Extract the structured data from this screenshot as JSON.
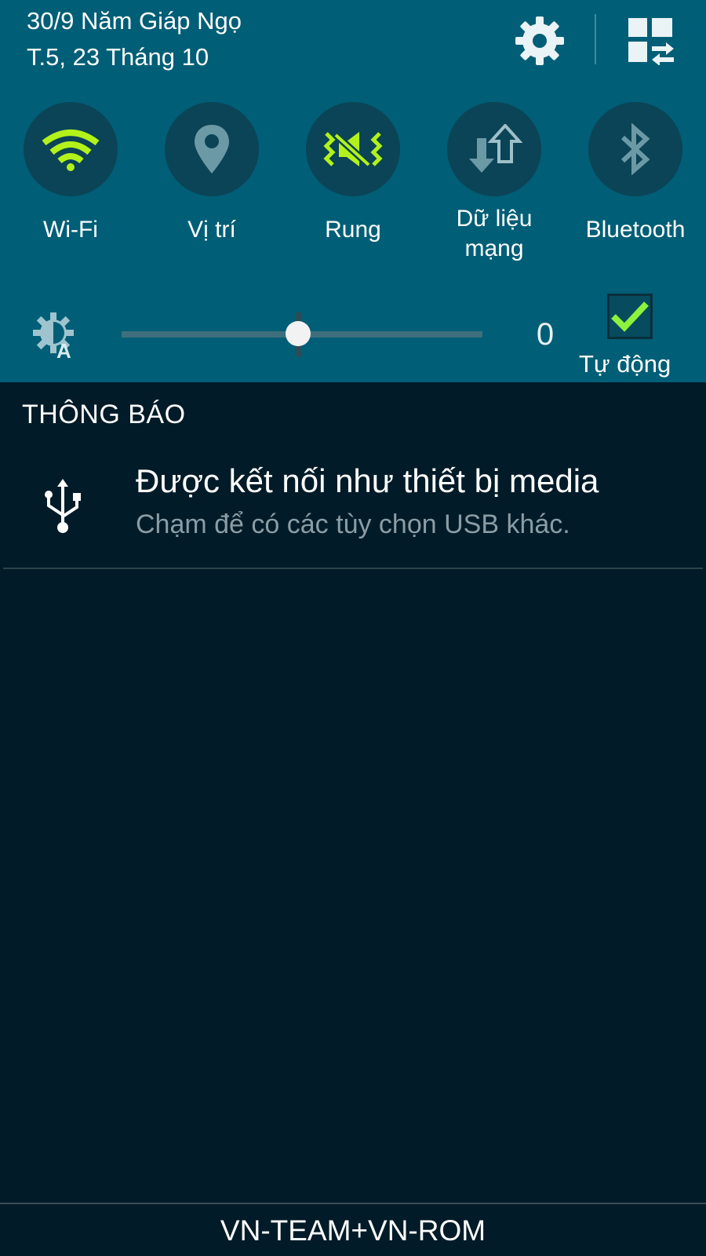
{
  "header": {
    "date_line_1": "30/9 Năm Giáp Ngọ",
    "date_line_2": "T.5, 23 Tháng 10",
    "settings_icon": "gear-icon",
    "edit_icon": "grid-swap-icon"
  },
  "quick_toggles": [
    {
      "label": "Wi-Fi",
      "icon": "wifi-icon",
      "active": true
    },
    {
      "label": "Vị trí",
      "icon": "location-pin-icon",
      "active": false
    },
    {
      "label": "Rung",
      "icon": "vibrate-icon",
      "active": true
    },
    {
      "label": "Dữ liệu\nmạng",
      "icon": "mobile-data-icon",
      "active": false
    },
    {
      "label": "Bluetooth",
      "icon": "bluetooth-icon",
      "active": false
    }
  ],
  "brightness": {
    "icon": "auto-brightness-icon",
    "level_fraction": 0.49,
    "value": "0",
    "auto_checked": true,
    "auto_label": "Tự động"
  },
  "notifications": {
    "header": "THÔNG BÁO",
    "items": [
      {
        "icon": "usb-icon",
        "title": "Được kết nối như thiết bị media",
        "subtitle": "Chạm để có các tùy chọn USB khác."
      }
    ]
  },
  "footer": {
    "carrier": "VN-TEAM+VN-ROM"
  },
  "colors": {
    "panel_bg": "#005e76",
    "toggle_bg": "#0b4456",
    "active_accent": "#b2f21a",
    "inactive_icon": "#6c99a6",
    "notification_bg": "#011b28"
  }
}
